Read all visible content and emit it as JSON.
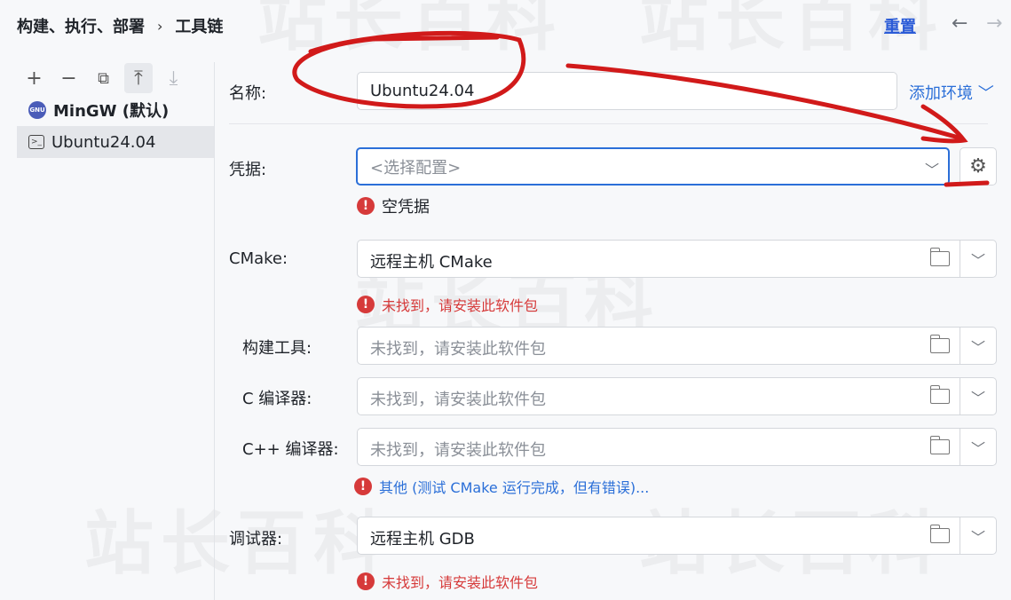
{
  "breadcrumb": {
    "items": [
      "构建、执行、部署",
      "工具链"
    ],
    "separator": "›"
  },
  "header": {
    "reset_label": "重置",
    "back_icon": "arrow-left-icon",
    "forward_icon": "arrow-right-icon"
  },
  "sidebar": {
    "toolbar": [
      "add-icon",
      "remove-icon",
      "copy-icon",
      "move-up-icon",
      "move-down-icon"
    ],
    "items": [
      {
        "label": "MinGW (默认)",
        "icon": "gnu-icon"
      },
      {
        "label": "Ubuntu24.04",
        "icon": "terminal-icon",
        "selected": true
      }
    ]
  },
  "form": {
    "name_label": "名称:",
    "name_value": "Ubuntu24.04",
    "add_env_label": "添加环境 ﹀",
    "credentials_label": "凭据:",
    "credentials_placeholder": "<选择配置>",
    "credentials_error": "空凭据",
    "cmake_label": "CMake:",
    "cmake_value": "远程主机 CMake",
    "cmake_error": "未找到，请安装此软件包",
    "build_tool_label": "构建工具:",
    "build_tool_value": "未找到，请安装此软件包",
    "c_compiler_label": "C 编译器:",
    "c_compiler_value": "未找到，请安装此软件包",
    "cpp_compiler_label": "C++ 编译器:",
    "cpp_compiler_value": "未找到，请安装此软件包",
    "compiler_error": "其他 (测试 CMake 运行完成，但有错误)...",
    "debugger_label": "调试器:",
    "debugger_value": "远程主机 GDB",
    "debugger_error": "未找到，请安装此软件包"
  },
  "watermark": "站长百科",
  "colors": {
    "accent": "#2b6fd8",
    "error": "#d63a3a",
    "annotation": "#d11a1a"
  }
}
